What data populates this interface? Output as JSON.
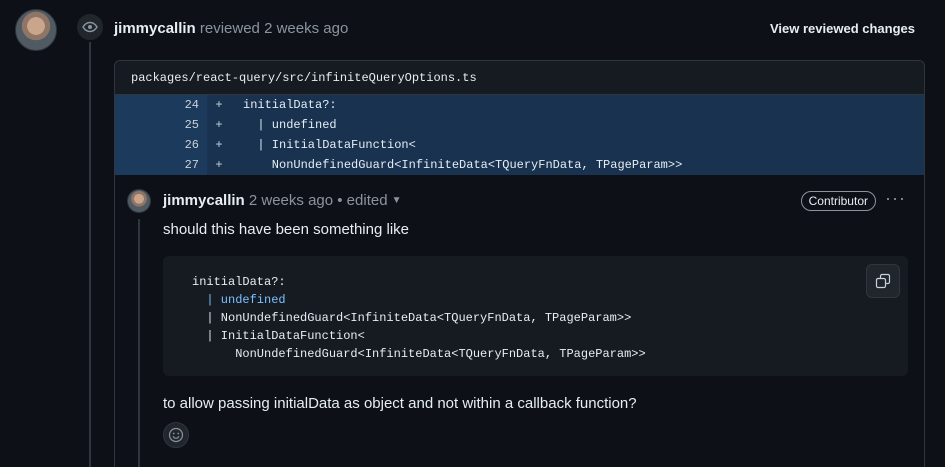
{
  "review": {
    "author": "jimmycallin",
    "action_text": "reviewed 2 weeks ago",
    "view_changes_label": "View reviewed changes"
  },
  "file": {
    "path": "packages/react-query/src/infiniteQueryOptions.ts"
  },
  "diff": {
    "lines": [
      {
        "num": "24",
        "sign": "+",
        "code": "initialData?:"
      },
      {
        "num": "25",
        "sign": "+",
        "code": "  | undefined"
      },
      {
        "num": "26",
        "sign": "+",
        "code": "  | InitialDataFunction<"
      },
      {
        "num": "27",
        "sign": "+",
        "code": "    NonUndefinedGuard<InfiniteData<TQueryFnData, TPageParam>>"
      }
    ]
  },
  "comment": {
    "author": "jimmycallin",
    "meta_text": "2 weeks ago • edited",
    "badge": "Contributor",
    "more_label": "···",
    "body_1": "should this have been something like",
    "code_lines": [
      "initialData?:",
      "  | undefined",
      "  | NonUndefinedGuard<InfiniteData<TQueryFnData, TPageParam>>",
      "  | InitialDataFunction<",
      "      NonUndefinedGuard<InfiniteData<TQueryFnData, TPageParam>>"
    ],
    "body_2": "to allow passing initialData as object and not within a callback function?"
  },
  "colors": {
    "background": "#0d1117",
    "diff_added": "#183250",
    "keyword": "#79c0ff",
    "border": "#30363d"
  },
  "icons": {
    "review": "eye-icon",
    "copy": "copy-icon",
    "reaction": "smiley-icon",
    "dropdown": "triangle-down-icon"
  }
}
